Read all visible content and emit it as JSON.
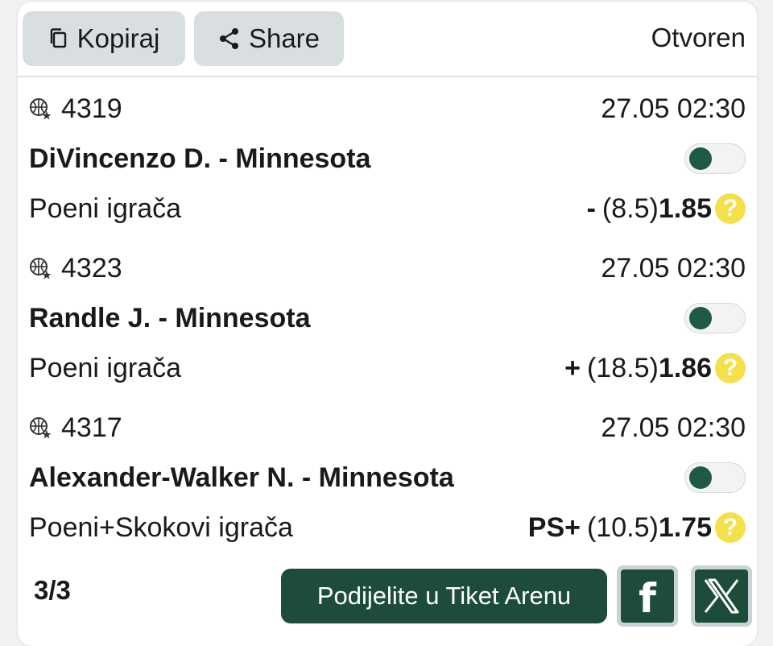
{
  "header": {
    "copy_label": "Kopiraj",
    "share_label": "Share",
    "status": "Otvoren"
  },
  "bets": [
    {
      "code": "4319",
      "datetime": "27.05 02:30",
      "match": "DiVincenzo D. - Minnesota",
      "market": "Poeni igrača",
      "pick": "-",
      "line": "(8.5)",
      "odd": "1.85",
      "toggle_on": false
    },
    {
      "code": "4323",
      "datetime": "27.05 02:30",
      "match": "Randle J. - Minnesota",
      "market": "Poeni igrača",
      "pick": "+",
      "line": "(18.5)",
      "odd": "1.86",
      "toggle_on": false
    },
    {
      "code": "4317",
      "datetime": "27.05 02:30",
      "match": "Alexander-Walker N. - Minnesota",
      "market": "Poeni+Skokovi igrača",
      "pick": "PS+",
      "line": "(10.5)",
      "odd": "1.75",
      "toggle_on": false
    }
  ],
  "footer": {
    "count": "3/3",
    "arena_label": "Podijelite u Tiket Arenu",
    "facebook_icon": "facebook-icon",
    "x_icon": "x-icon"
  },
  "colors": {
    "brand_green": "#1d4d3a",
    "button_gray": "#d9dee1",
    "help_yellow": "#f4e04a"
  }
}
